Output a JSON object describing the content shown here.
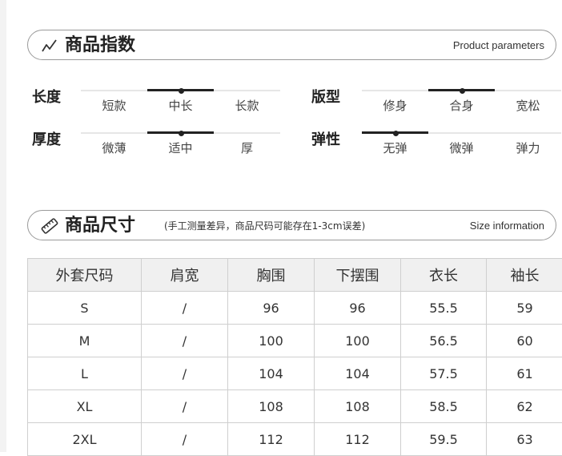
{
  "params_section": {
    "title": "商品指数",
    "subtitle_en": "Product parameters",
    "rows": [
      {
        "left": {
          "label": "长度",
          "options": [
            "短款",
            "中长",
            "长款"
          ],
          "selected": 1
        },
        "right": {
          "label": "版型",
          "options": [
            "修身",
            "合身",
            "宽松"
          ],
          "selected": 1
        }
      },
      {
        "left": {
          "label": "厚度",
          "options": [
            "微薄",
            "适中",
            "厚"
          ],
          "selected": 1
        },
        "right": {
          "label": "弹性",
          "options": [
            "无弹",
            "微弹",
            "弹力"
          ],
          "selected": 0
        }
      }
    ]
  },
  "size_section": {
    "title": "商品尺寸",
    "note": "(手工测量差异，商品尺码可能存在1-3cm误差)",
    "subtitle_en": "Size information",
    "headers": [
      "外套尺码",
      "肩宽",
      "胸围",
      "下摆围",
      "衣长",
      "袖长"
    ],
    "rows": [
      [
        "S",
        "/",
        "96",
        "96",
        "55.5",
        "59"
      ],
      [
        "M",
        "/",
        "100",
        "100",
        "56.5",
        "60"
      ],
      [
        "L",
        "/",
        "104",
        "104",
        "57.5",
        "61"
      ],
      [
        "XL",
        "/",
        "108",
        "108",
        "58.5",
        "62"
      ],
      [
        "2XL",
        "/",
        "112",
        "112",
        "59.5",
        "63"
      ]
    ]
  },
  "icons": {
    "params": "trend-line-icon",
    "size": "ruler-icon"
  }
}
